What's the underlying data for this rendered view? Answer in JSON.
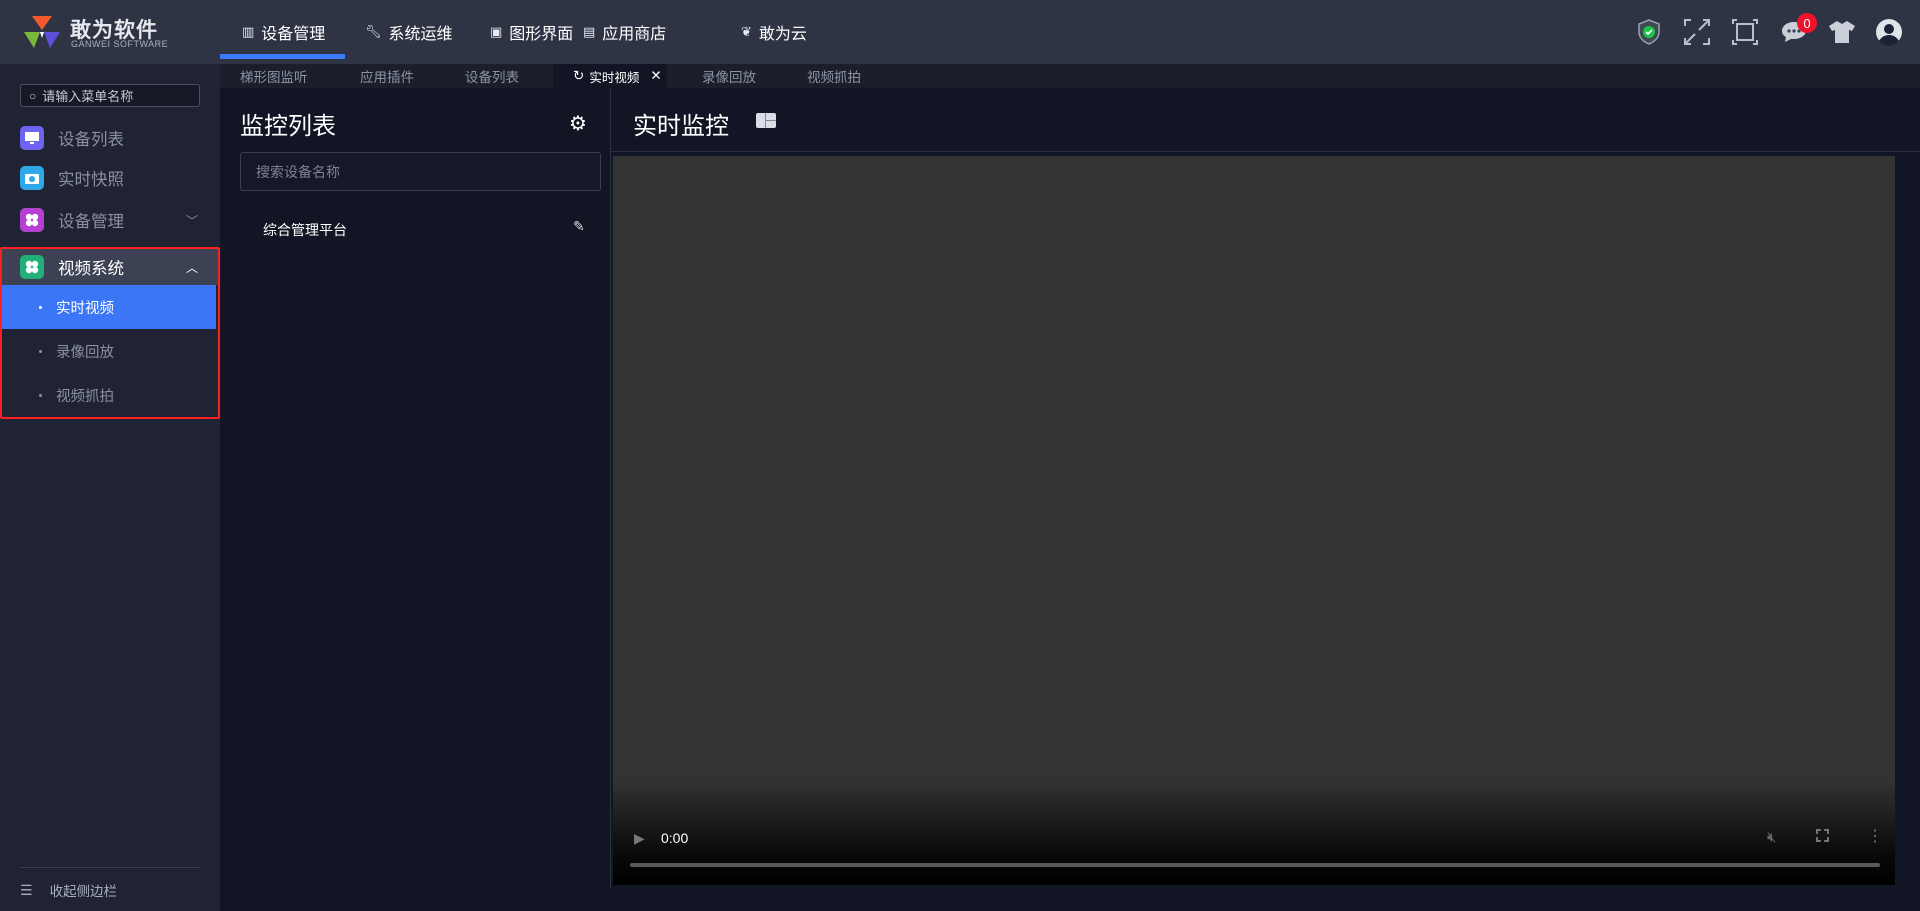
{
  "brand": {
    "name": "敢为软件",
    "subtitle": "GANWEI SOFTWARE"
  },
  "top_nav": [
    {
      "label": "设备管理",
      "icon": "book-icon",
      "active": true
    },
    {
      "label": "系统运维",
      "icon": "wrench-icon"
    },
    {
      "label": "图形界面",
      "icon": "monitor-icon"
    },
    {
      "label": "应用商店",
      "icon": "store-icon"
    },
    {
      "label": "敢为云",
      "icon": "cloud-icon"
    }
  ],
  "header_icons": {
    "notification_count": "0"
  },
  "tabs": [
    {
      "label": "梯形图监听"
    },
    {
      "label": "应用插件"
    },
    {
      "label": "设备列表"
    },
    {
      "label": "实时视频",
      "active": true
    },
    {
      "label": "录像回放"
    },
    {
      "label": "视频抓拍"
    }
  ],
  "sidebar": {
    "search_placeholder": "请输入菜单名称",
    "items": [
      {
        "label": "设备列表",
        "color": "#6c63f0"
      },
      {
        "label": "实时快照",
        "color": "#2ea7e8"
      },
      {
        "label": "设备管理",
        "color": "#b43fd0"
      },
      {
        "label": "视频系统",
        "color": "#22b07a"
      }
    ],
    "sub_items": [
      {
        "label": "实时视频",
        "active": true
      },
      {
        "label": "录像回放"
      },
      {
        "label": "视频抓拍"
      }
    ],
    "collapse_label": "收起侧边栏"
  },
  "monitor_list": {
    "title": "监控列表",
    "search_placeholder": "搜索设备名称",
    "items": [
      {
        "label": "综合管理平台"
      }
    ]
  },
  "live": {
    "title": "实时监控",
    "time": "0:00"
  },
  "colors": {
    "accent": "#3b7cff",
    "highlight": "#ff1f1f",
    "badge": "#f0112a"
  }
}
